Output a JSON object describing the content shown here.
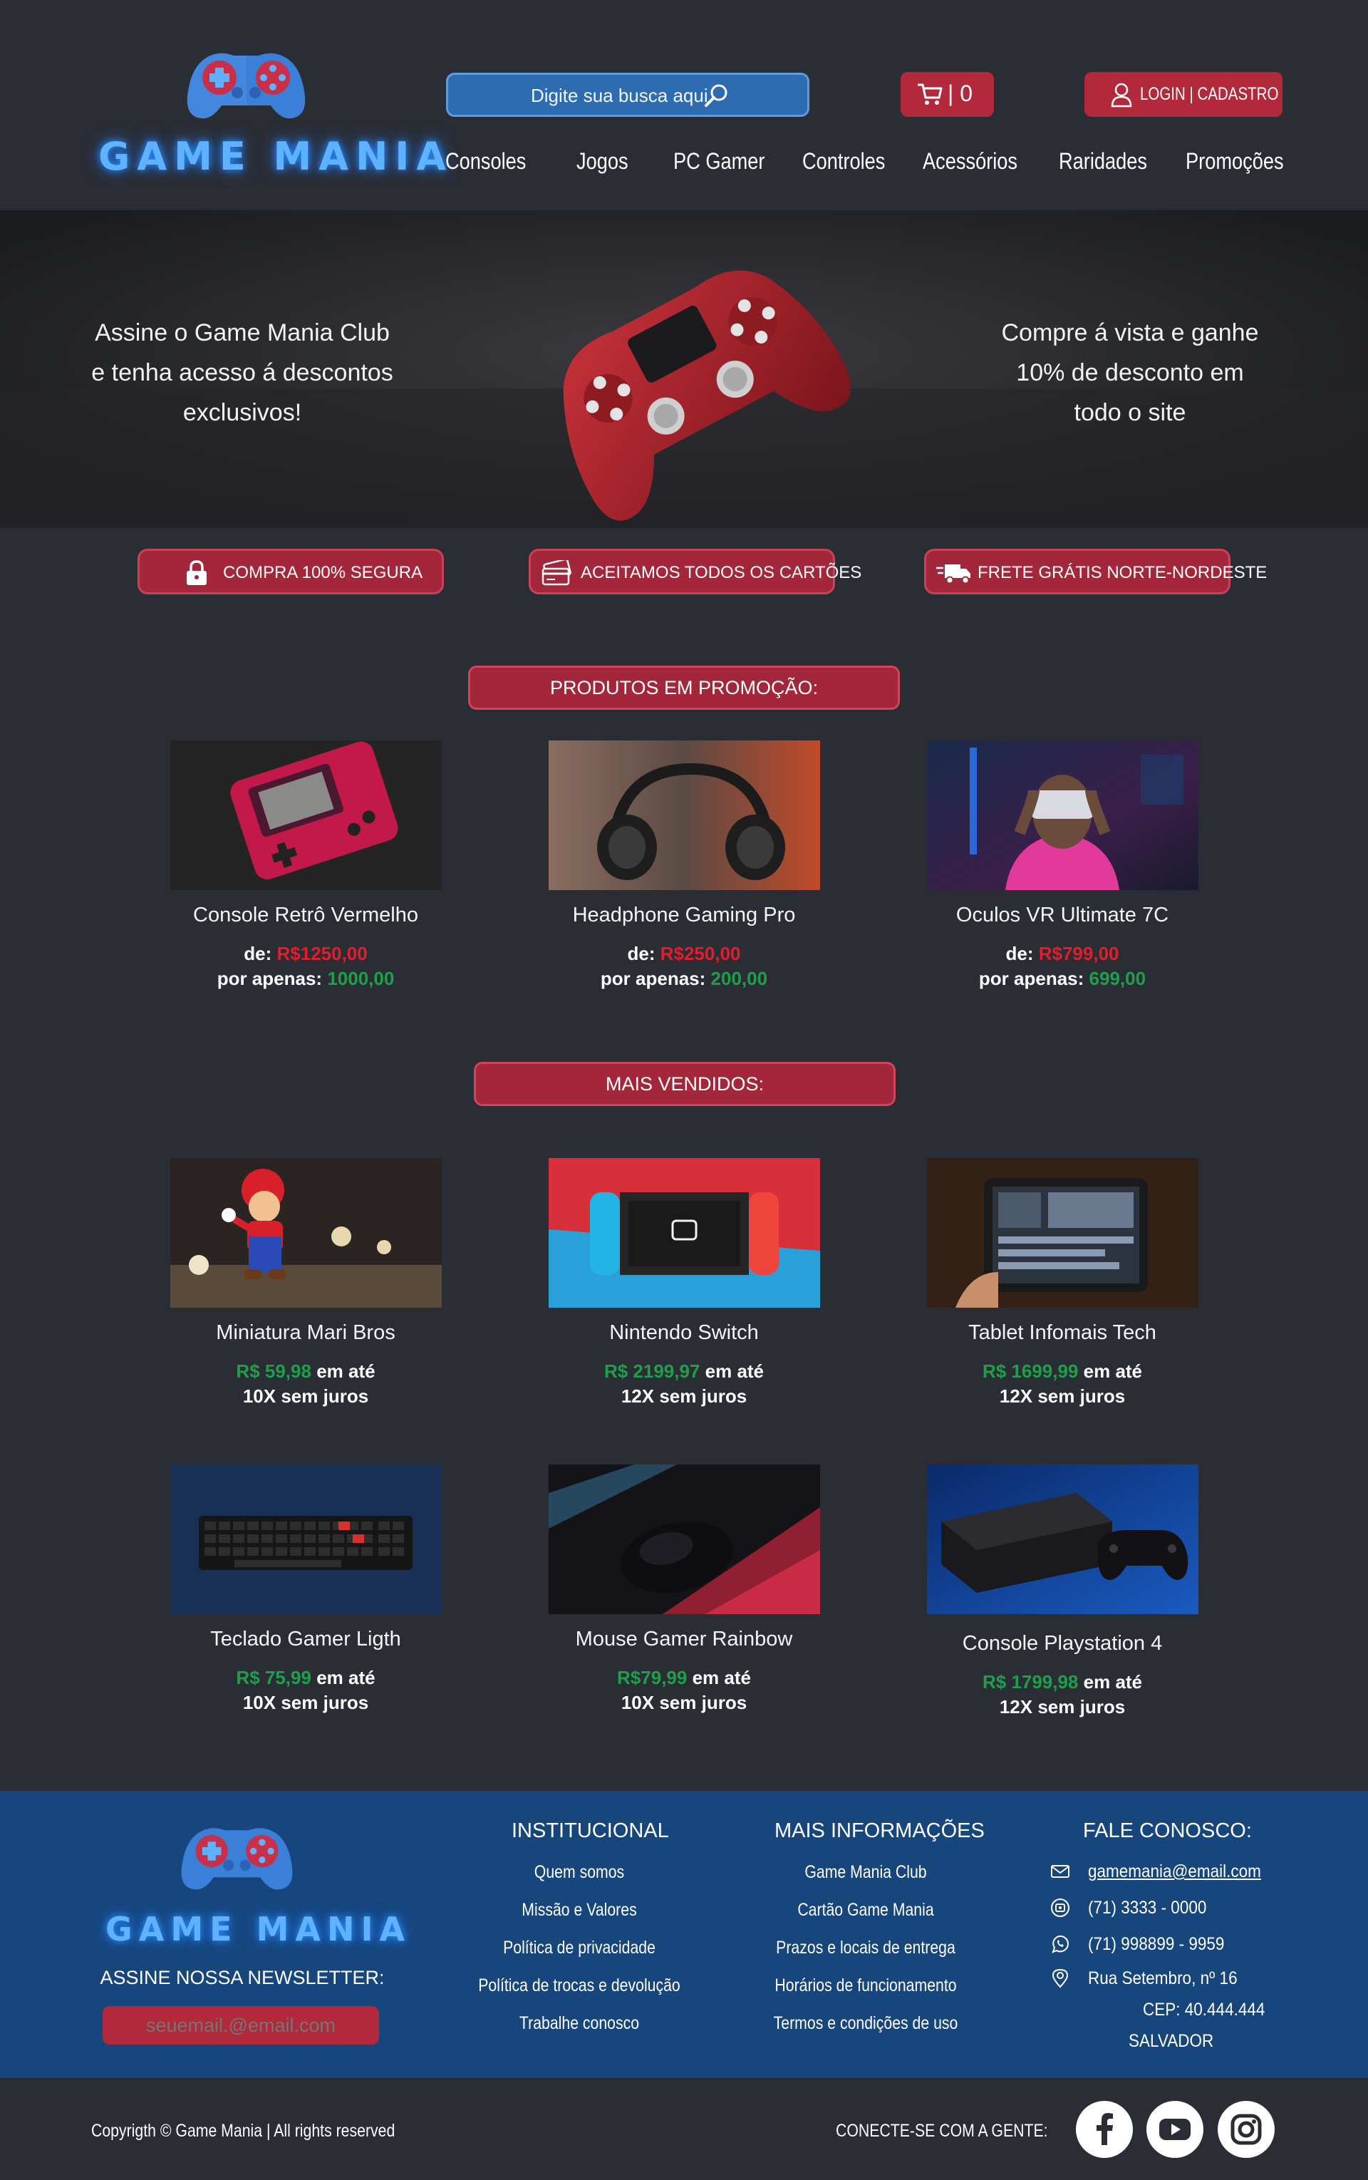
{
  "brand": {
    "name": "GAME MANIA"
  },
  "search": {
    "placeholder": "Digite sua busca aqui"
  },
  "cart": {
    "label": "| 0"
  },
  "login": {
    "label": "LOGIN | CADASTRO"
  },
  "nav": [
    "Consoles",
    "Jogos",
    "PC Gamer",
    "Controles",
    "Acessórios",
    "Raridades",
    "Promoções"
  ],
  "banner": {
    "left_lines": [
      "Assine o  Game Mania Club",
      "e tenha acesso á descontos",
      "exclusivos!"
    ],
    "right_lines": [
      "Compre á vista e ganhe",
      "10% de desconto em",
      "todo o site"
    ]
  },
  "features": [
    "COMPRA 100% SEGURA",
    "ACEITAMOS  TODOS OS CARTÕES",
    "FRETE GRÁTIS NORTE-NORDESTE"
  ],
  "promo": {
    "title": "PRODUTOS EM PROMOÇÃO:",
    "from_label": "de:",
    "now_label": "por apenas:",
    "items": [
      {
        "name": "Console Retrô Vermelho",
        "old_price": "R$1250,00",
        "new_price": "1000,00"
      },
      {
        "name": "Headphone Gaming Pro",
        "old_price": "R$250,00",
        "new_price": "200,00"
      },
      {
        "name": "Oculos VR Ultimate 7C",
        "old_price": "R$799,00",
        "new_price": "699,00"
      }
    ]
  },
  "bestsellers": {
    "title": "MAIS VENDIDOS:",
    "installment_label": "em até",
    "items": [
      {
        "name": "Miniatura Mari Bros",
        "price": "R$ 59,98",
        "price_color": "#1ea04b",
        "installments": "10X sem juros"
      },
      {
        "name": "Nintendo Switch",
        "price": "R$ 2199,97",
        "price_color": "#1ea04b",
        "installments": "12X sem juros"
      },
      {
        "name": "Tablet Infomais Tech",
        "price": "R$ 1699,99",
        "price_color": "#1ea04b",
        "installments": "12X sem juros"
      },
      {
        "name": "Teclado Gamer Ligth",
        "price": "R$ 75,99",
        "price_color": "#1ea04b",
        "installments": "10X sem juros"
      },
      {
        "name": "Mouse Gamer Rainbow",
        "price": "R$79,99",
        "price_color": "#1ea04b",
        "installments": "10X sem juros"
      },
      {
        "name": "Console Playstation 4",
        "price": "R$ 1799,98",
        "price_color": "#1ea04b",
        "installments": "12X sem juros"
      }
    ]
  },
  "footer": {
    "newsletter_title": "ASSINE NOSSA NEWSLETTER:",
    "newsletter_placeholder": "seuemail.@email.com",
    "institucional": {
      "title": "INSTITUCIONAL",
      "links": [
        "Quem somos",
        "Missão e Valores",
        "Política de privacidade",
        "Política de trocas e devolução",
        "Trabalhe conosco"
      ]
    },
    "mais_info": {
      "title": "MAIS INFORMAÇÕES",
      "links": [
        "Game Mania Club",
        "Cartão Game Mania",
        "Prazos e locais de entrega",
        "Horários de funcionamento",
        "Termos e condições de uso"
      ]
    },
    "contato": {
      "title": "FALE CONOSCO:",
      "email": "gamemania@email.com",
      "phone": "(71) 3333 - 0000",
      "whatsapp": "(71) 998899 - 9959",
      "address_line1": "Rua  Setembro, nº 16",
      "address_line2": "CEP: 40.444.444",
      "address_line3": "SALVADOR"
    }
  },
  "bottom": {
    "copyright": "Copyrigth © Game Mania | All rights reserved",
    "connect": "CONECTE-SE COM A GENTE:",
    "social": [
      "facebook-icon",
      "youtube-icon",
      "instagram-icon"
    ]
  },
  "colors": {
    "background": "#2b2d35",
    "accent_red": "#b3293c",
    "footer_blue": "#17467c",
    "price_old": "#e51c2c",
    "price_new": "#1ea04b",
    "search_blue": "#2d6cb0"
  }
}
